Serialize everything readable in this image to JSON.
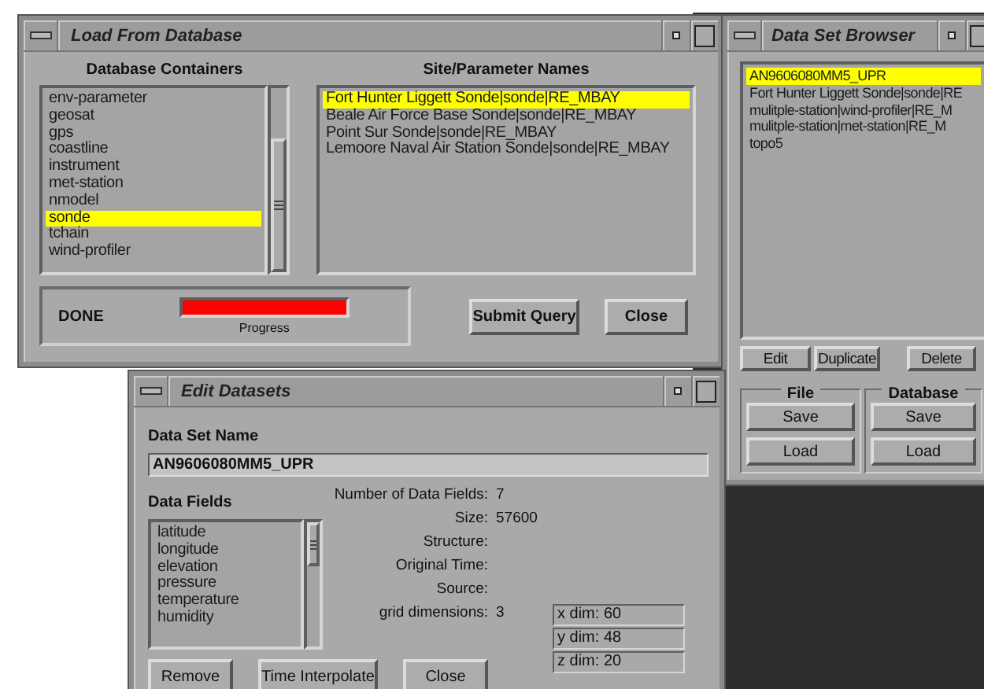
{
  "load_window": {
    "title": "Load From Database",
    "containers": {
      "heading": "Database Containers",
      "items": [
        {
          "label": "env-parameter",
          "selected": false
        },
        {
          "label": "geosat",
          "selected": false
        },
        {
          "label": "gps",
          "selected": false
        },
        {
          "label": "coastline",
          "selected": false
        },
        {
          "label": "instrument",
          "selected": false
        },
        {
          "label": "met-station",
          "selected": false
        },
        {
          "label": "nmodel",
          "selected": false
        },
        {
          "label": "sonde",
          "selected": true
        },
        {
          "label": "tchain",
          "selected": false
        },
        {
          "label": "wind-profiler",
          "selected": false
        }
      ]
    },
    "sites": {
      "heading": "Site/Parameter Names",
      "items": [
        {
          "label": "Fort Hunter Liggett Sonde|sonde|RE_MBAY",
          "selected": true
        },
        {
          "label": "Beale Air Force Base Sonde|sonde|RE_MBAY",
          "selected": false
        },
        {
          "label": "Point Sur Sonde|sonde|RE_MBAY",
          "selected": false
        },
        {
          "label": "Lemoore Naval Air Station Sonde|sonde|RE_MBAY",
          "selected": false
        }
      ]
    },
    "status": "DONE",
    "progress": {
      "level": 1,
      "label": "Progress"
    },
    "buttons": [
      "Submit Query",
      "Close"
    ]
  },
  "browser_window": {
    "title": "Data Set Browser",
    "items": [
      {
        "label": "AN9606080MM5_UPR",
        "selected": true
      },
      {
        "label": "Fort Hunter Liggett Sonde|sonde|RE",
        "selected": false
      },
      {
        "label": "mulitple-station|wind-profiler|RE_M",
        "selected": false
      },
      {
        "label": "mulitple-station|met-station|RE_M",
        "selected": false
      },
      {
        "label": "topo5",
        "selected": false
      }
    ],
    "buttons": [
      "Edit",
      "Duplicate",
      "Delete"
    ],
    "groups": [
      {
        "heading": "File",
        "buttons": [
          "Save",
          "Load"
        ]
      },
      {
        "heading": "Database",
        "buttons": [
          "Save",
          "Load"
        ]
      }
    ]
  },
  "edit_window": {
    "title": "Edit Datasets",
    "name_label": "Data Set Name",
    "name_value": "AN9606080MM5_UPR",
    "fields_label": "Data Fields",
    "fields": [
      "latitude",
      "longitude",
      "elevation",
      "pressure",
      "temperature",
      "humidity"
    ],
    "info": [
      {
        "label": "Number of Data Fields:",
        "value": "7"
      },
      {
        "label": "Size:",
        "value": "57600"
      },
      {
        "label": "Structure:"
      },
      {
        "label": "Original Time:"
      },
      {
        "label": "Source:"
      },
      {
        "label": "grid dimensions:",
        "value": "3"
      }
    ],
    "dims": [
      "x dim: 60",
      "y dim: 48",
      "z dim: 20"
    ],
    "buttons": [
      "Remove",
      "Time Interpolate",
      "Close"
    ]
  }
}
